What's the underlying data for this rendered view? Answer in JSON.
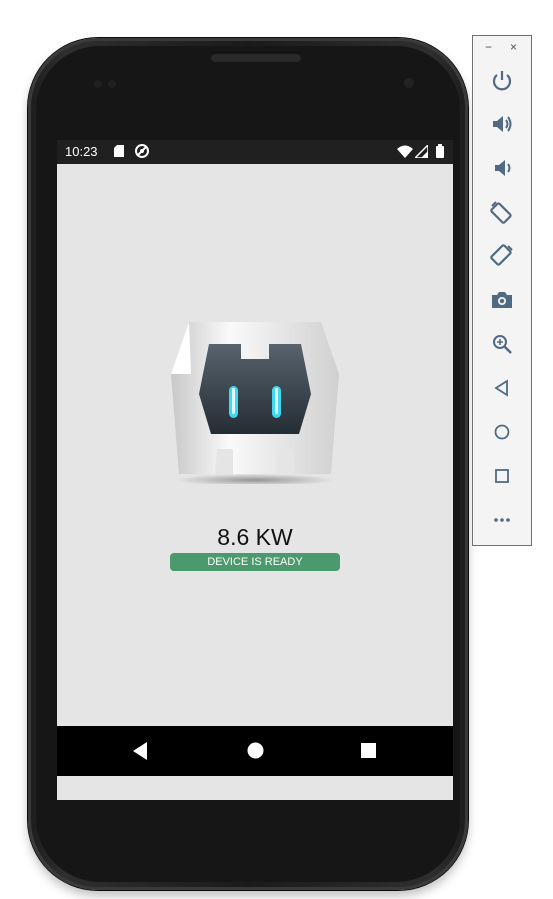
{
  "status_bar": {
    "time": "10:23",
    "icons": [
      "sd-card-icon",
      "sync-icon",
      "wifi-icon",
      "signal-icon",
      "battery-icon"
    ]
  },
  "app": {
    "logo": "cordova-logo",
    "power_value": "8.6 KW",
    "status_badge": "DEVICE IS READY",
    "badge_color": "#4b9a6d",
    "background_color": "#e5e5e5"
  },
  "navigation_bar": {
    "buttons": [
      "back-icon",
      "home-icon",
      "recents-icon"
    ]
  },
  "emulator_toolbar": {
    "window_controls": {
      "minimize": "−",
      "close": "×"
    },
    "buttons": [
      "power-icon",
      "volume-up-icon",
      "volume-down-icon",
      "rotate-left-icon",
      "rotate-right-icon",
      "camera-icon",
      "zoom-icon",
      "back-icon",
      "home-icon",
      "overview-icon",
      "more-icon"
    ],
    "icon_color": "#4f6a82"
  }
}
